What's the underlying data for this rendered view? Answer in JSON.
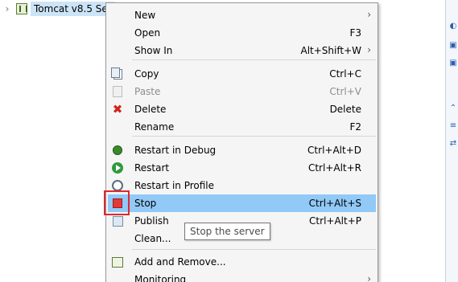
{
  "tree": {
    "chevron": "›",
    "server_label": "Tomcat v8.5 Ser",
    "server_icon": "server-icon"
  },
  "menu": {
    "items": [
      {
        "label": "New",
        "shortcut": "",
        "submenu": true,
        "icon": ""
      },
      {
        "label": "Open",
        "shortcut": "F3",
        "submenu": false,
        "icon": ""
      },
      {
        "label": "Show In",
        "shortcut": "Alt+Shift+W",
        "submenu": true,
        "icon": ""
      },
      {
        "label": "Copy",
        "shortcut": "Ctrl+C",
        "submenu": false,
        "icon": "copy-icon"
      },
      {
        "label": "Paste",
        "shortcut": "Ctrl+V",
        "submenu": false,
        "icon": "paste-icon",
        "disabled": true
      },
      {
        "label": "Delete",
        "shortcut": "Delete",
        "submenu": false,
        "icon": "delete-icon"
      },
      {
        "label": "Rename",
        "shortcut": "F2",
        "submenu": false,
        "icon": ""
      },
      {
        "label": "Restart in Debug",
        "shortcut": "Ctrl+Alt+D",
        "submenu": false,
        "icon": "debug-icon"
      },
      {
        "label": "Restart",
        "shortcut": "Ctrl+Alt+R",
        "submenu": false,
        "icon": "play-icon"
      },
      {
        "label": "Restart in Profile",
        "shortcut": "",
        "submenu": false,
        "icon": "profile-icon"
      },
      {
        "label": "Stop",
        "shortcut": "Ctrl+Alt+S",
        "submenu": false,
        "icon": "stop-icon",
        "highlighted": true
      },
      {
        "label": "Publish",
        "shortcut": "Ctrl+Alt+P",
        "submenu": false,
        "icon": "publish-icon"
      },
      {
        "label": "Clean...",
        "shortcut": "",
        "submenu": false,
        "icon": ""
      },
      {
        "label": "Add and Remove...",
        "shortcut": "",
        "submenu": false,
        "icon": "add-remove-icon"
      },
      {
        "label": "Monitoring",
        "shortcut": "",
        "submenu": true,
        "icon": ""
      }
    ],
    "submenu_arrow": "›"
  },
  "tooltip": {
    "text": "Stop the server"
  },
  "colors": {
    "highlight": "#91c9f7",
    "annotation_box": "#e0282d",
    "menu_bg": "#f5f5f5"
  }
}
